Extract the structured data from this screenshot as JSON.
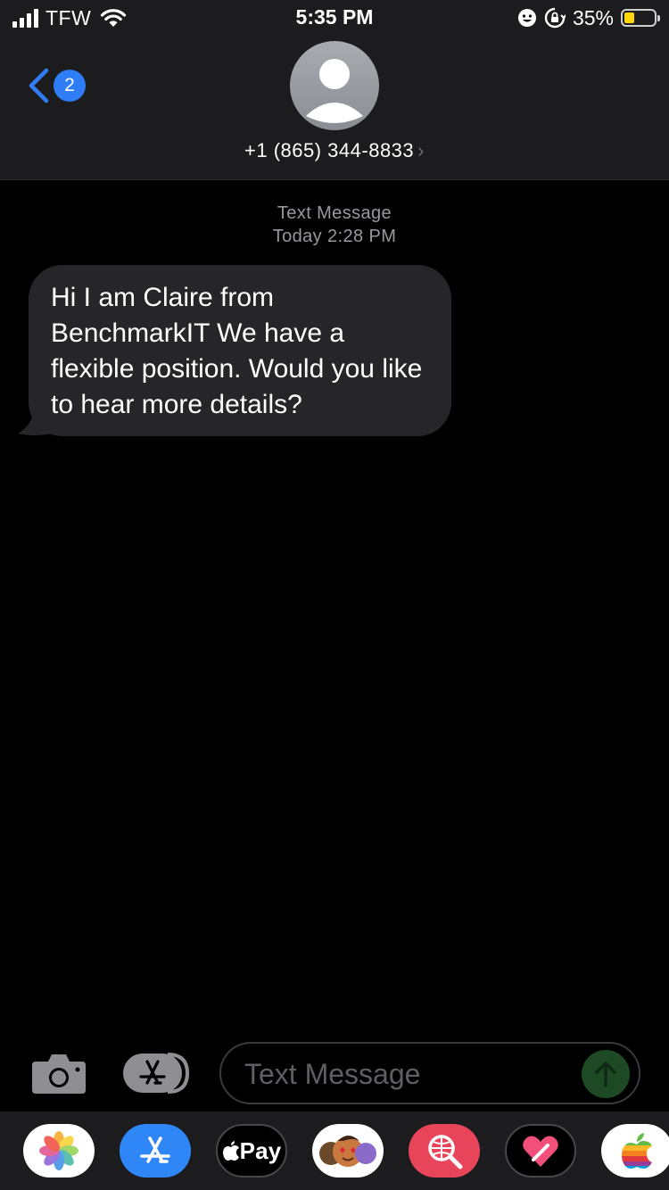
{
  "status_bar": {
    "carrier": "TFW",
    "time": "5:35 PM",
    "battery_percent_text": "35%",
    "battery_level": 0.35,
    "battery_color": "#ffd60a",
    "icons": [
      "signal-icon",
      "wifi-icon",
      "face-icon",
      "rotation-lock-icon",
      "battery-icon"
    ]
  },
  "header": {
    "back_badge_count": "2",
    "contact_number": "+1 (865) 344-8833",
    "accent_color": "#2f7df6"
  },
  "thread": {
    "service_label": "Text Message",
    "timestamp": "Today 2:28 PM",
    "messages": [
      {
        "direction": "incoming",
        "text": "Hi I am Claire from BenchmarkIT We have a flexible position. Would you like to hear more details?"
      }
    ]
  },
  "composer": {
    "placeholder": "Text Message",
    "value": ""
  },
  "app_drawer": {
    "apps": [
      "photos-app-icon",
      "app-store-icon",
      "apple-pay-icon",
      "memoji-icon",
      "web-search-icon",
      "digital-touch-icon",
      "apple-app-icon"
    ],
    "apple_pay_label": "Pay"
  }
}
